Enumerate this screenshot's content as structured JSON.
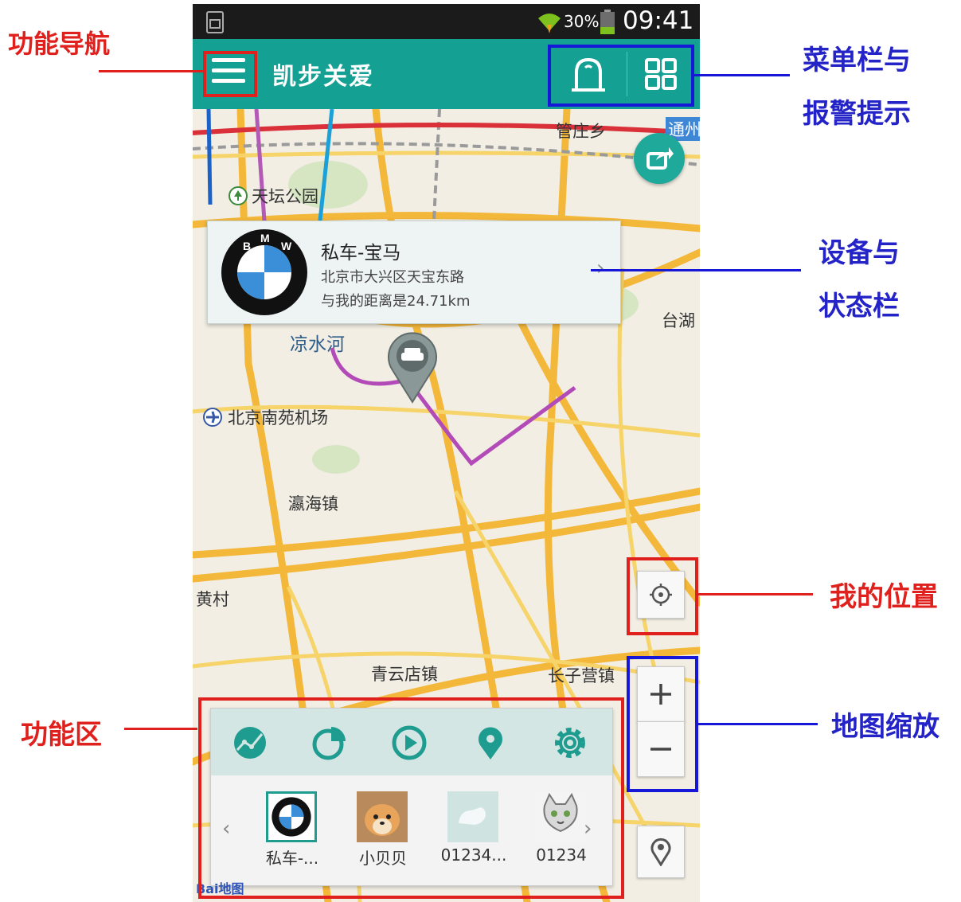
{
  "status_bar": {
    "battery_percent": "30%",
    "time": "09:41",
    "icons": [
      "sim-card-icon",
      "wifi-icon",
      "battery-icon"
    ]
  },
  "toolbar": {
    "title": "凯步关爱",
    "icons": [
      "menu-icon",
      "alarm-bell-icon",
      "grid-menu-icon"
    ]
  },
  "map": {
    "labels": {
      "guanzhuang": "管庄乡",
      "tongzhou": "通州",
      "tiantan": "天坛公园",
      "taihu": "台湖",
      "liangshui": "凉水河",
      "nanyuan": "北京南苑机场",
      "yinghai": "瀛海镇",
      "huangcun": "黄村",
      "qingyundian": "青云店镇",
      "changziying": "长子营镇"
    },
    "provider_logo": "Bai地图"
  },
  "device_card": {
    "name": "私车-宝马",
    "address": "北京市大兴区天宝东路",
    "distance": "与我的距离是24.71km"
  },
  "function_bar": {
    "icons": [
      "track-icon",
      "pie-chart-icon",
      "playback-icon",
      "location-pin-icon",
      "settings-gear-icon"
    ]
  },
  "devices": [
    {
      "label": "私车-...",
      "thumb": "bmw-logo"
    },
    {
      "label": "小贝贝",
      "thumb": "dog-photo"
    },
    {
      "label": "01234...",
      "thumb": "placeholder-dog"
    },
    {
      "label": "01234",
      "thumb": "cat-cartoon"
    }
  ],
  "annotations": {
    "nav": "功能导航",
    "menu_alarm_1": "菜单栏与",
    "menu_alarm_2": "报警提示",
    "device_status_1": "设备与",
    "device_status_2": "状态栏",
    "my_location": "我的位置",
    "function_area": "功能区",
    "map_zoom": "地图缩放"
  },
  "colors": {
    "toolbar": "#14a093",
    "annotation_red": "#e0201c",
    "annotation_blue": "#2323c8"
  }
}
